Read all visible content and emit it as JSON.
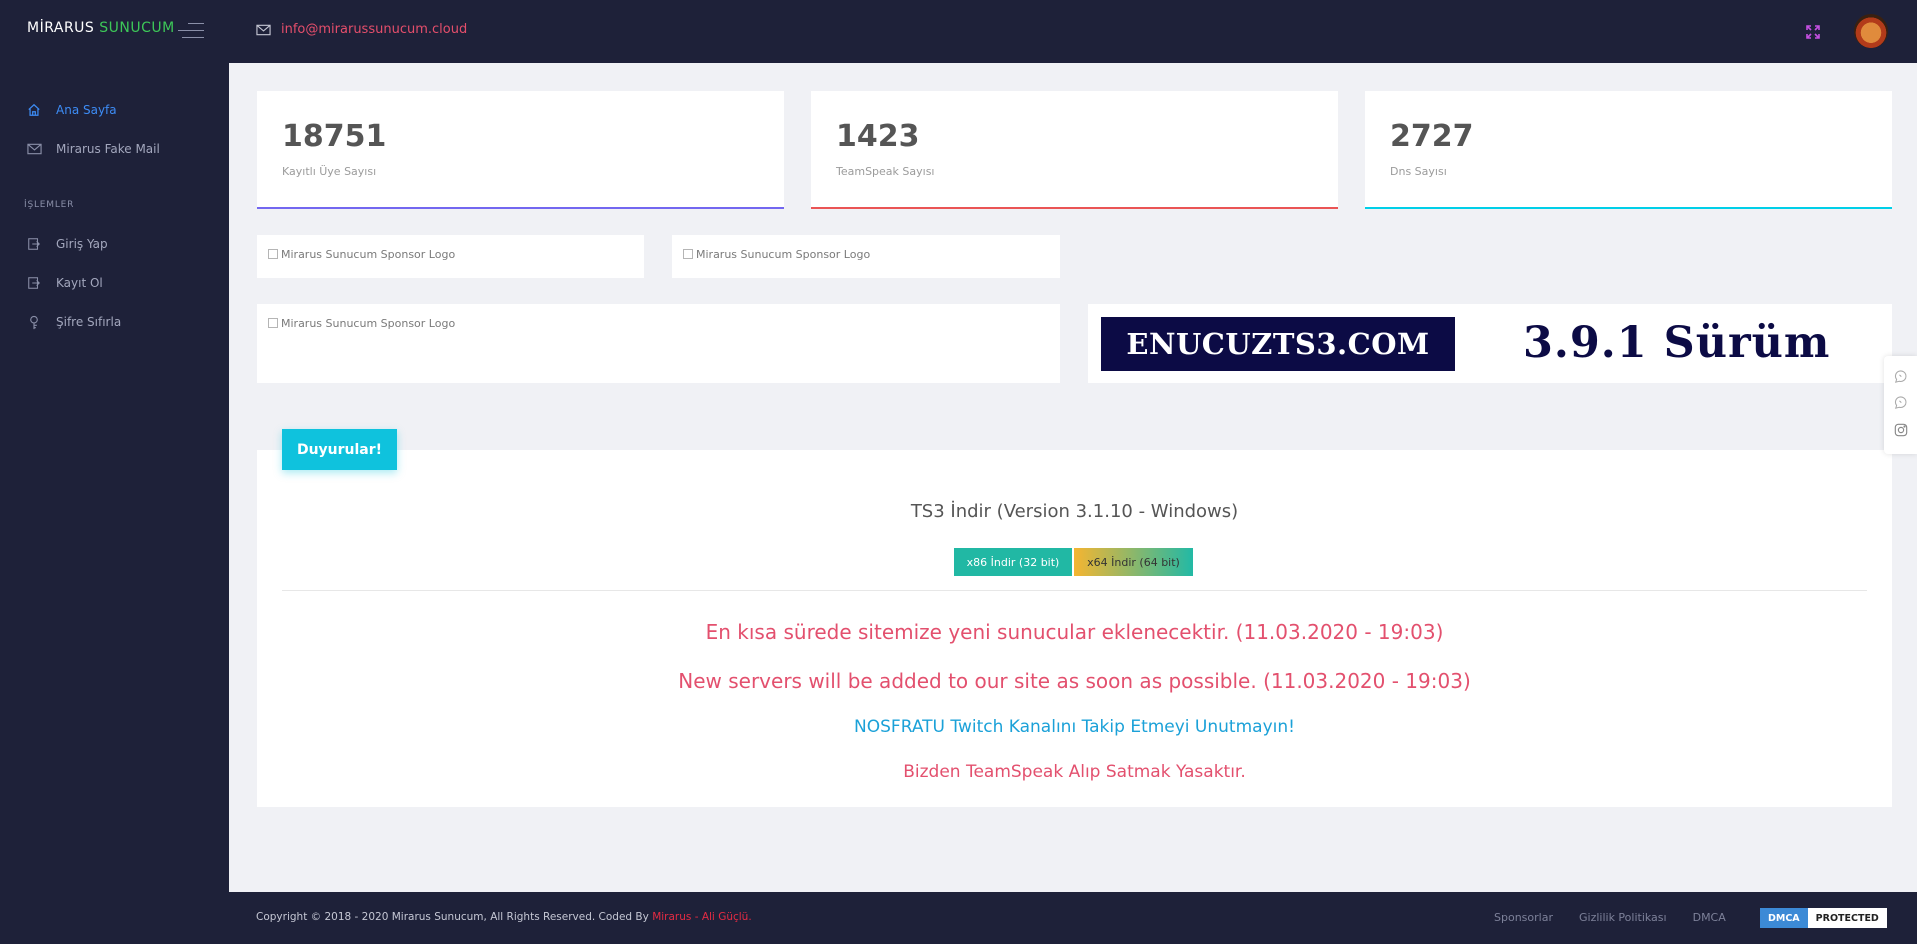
{
  "sidebar": {
    "brand_part1": "MİRARUS ",
    "brand_part2": "SUNUCUM",
    "items": [
      {
        "label": "Ana Sayfa",
        "icon": "home-icon"
      },
      {
        "label": "Mirarus Fake Mail",
        "icon": "mail-icon"
      }
    ],
    "section_label": "İŞLEMLER",
    "actions": [
      {
        "label": "Giriş Yap",
        "icon": "login-icon"
      },
      {
        "label": "Kayıt Ol",
        "icon": "register-icon"
      },
      {
        "label": "Şifre Sıfırla",
        "icon": "key-icon"
      }
    ]
  },
  "header": {
    "email": "info@mirarussunucum.cloud"
  },
  "stats": [
    {
      "value": "18751",
      "label": "Kayıtlı Üye Sayısı",
      "color": "#7367f0"
    },
    {
      "value": "1423",
      "label": "TeamSpeak Sayısı",
      "color": "#ea5455"
    },
    {
      "value": "2727",
      "label": "Dns Sayısı",
      "color": "#00cfe8"
    }
  ],
  "sponsors": {
    "alt_text": "Mirarus Sunucum Sponsor Logo"
  },
  "banner": {
    "left_text": "ENUCUZTS3.COM",
    "right_text": "3.9.1 Sürüm"
  },
  "announcements": {
    "badge": "Duyurular!",
    "title": "TS3 İndir (Version 3.1.10 - Windows)",
    "btn_x86": "x86 İndir (32 bit)",
    "btn_x64": "x64 İndir (64 bit)",
    "line1": "En kısa sürede sitemize yeni sunucular eklenecektir. (11.03.2020 - 19:03)",
    "line2": "New servers will be added to our site as soon as possible. (11.03.2020 - 19:03)",
    "line3": "NOSFRATU Twitch Kanalını Takip Etmeyi Unutmayın!",
    "line4": "Bizden TeamSpeak Alıp Satmak Yasaktır."
  },
  "footer": {
    "copyright": "Copyright © 2018 - 2020 Mirarus Sunucum, All Rights Reserved. Coded By ",
    "author": "Mirarus - Ali Güçlü.",
    "links": [
      "Sponsorlar",
      "Gizlilik Politikası",
      "DMCA"
    ],
    "dmca_a": "DMCA",
    "dmca_b": "PROTECTED"
  }
}
